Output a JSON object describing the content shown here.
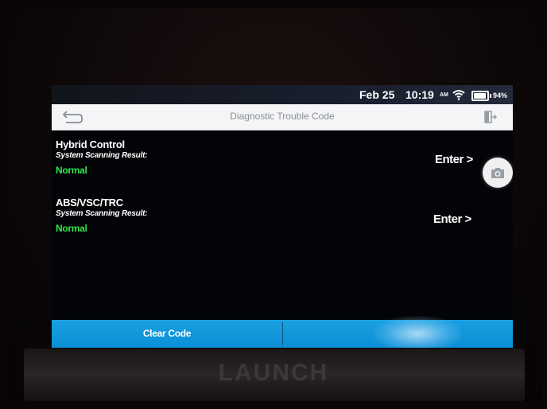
{
  "status_bar": {
    "date": "Feb 25",
    "time": "10:19",
    "ampm": "AM",
    "battery_percent": "94%",
    "battery_level": 0.94
  },
  "header": {
    "title": "Diagnostic Trouble Code",
    "back_icon": "back-arrow-icon",
    "exit_icon": "exit-door-icon"
  },
  "systems": [
    {
      "name": "Hybrid Control",
      "result_label": "System Scanning Result:",
      "result": "Normal",
      "enter_label": "Enter >"
    },
    {
      "name": "ABS/VSC/TRC",
      "result_label": "System Scanning Result:",
      "result": "Normal",
      "enter_label": "Enter >"
    }
  ],
  "actions": {
    "clear_code_label": "Clear Code"
  },
  "device": {
    "brand": "LAUNCH"
  },
  "colors": {
    "accent": "#0a8fd6",
    "normal_status": "#34e64a",
    "header_bg": "#f4f5f6"
  }
}
